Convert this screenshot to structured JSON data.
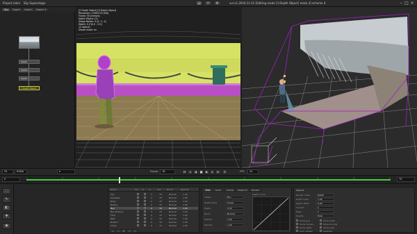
{
  "titlebar": {
    "project_label": "Project.mkm",
    "filename": "Sky Superstage",
    "title": "sur.v1.2019.11.01 [Editing mode [3 Depth Object] mask 4] scheme 4",
    "buttons": [
      "▤",
      "⟳",
      "⚙"
    ]
  },
  "tabs": [
    "Sky",
    "Depth 1",
    "Depth 2",
    "Depth 3"
  ],
  "nodes": {
    "items": [
      "Depth",
      "Depth 2",
      "Depth 3"
    ],
    "selected": "3 Depth Object"
  },
  "viewer": {
    "info": [
      "[3 Depth Object] [3 Depth Object]",
      "Resolution: 1280x720 [HD]",
      "Frame: 50 [frames]",
      "Depth Object: [3]",
      "Shape Nodes: 4 [4 / 1, 4]",
      "Depth: 0.0 [0.0 - 0.0]",
      "12 objects",
      "Shade mode: on"
    ]
  },
  "viewtool": {
    "zoom": "Fit",
    "channel": "RGBA",
    "frame_label": "Frame",
    "frame_value": "18",
    "fps_label": "FPS",
    "fps_value": "24"
  },
  "timeline": {
    "start": "0",
    "end": "70",
    "playhead": "18"
  },
  "layers": {
    "headers": [
      "Name",
      "Vis",
      "Lk",
      "In",
      "Out",
      "Blend",
      "Opacity"
    ],
    "rows": [
      {
        "name": "Sky",
        "in": "0",
        "out": "70",
        "blend": "Normal",
        "opacity": "1.00"
      },
      {
        "name": "Sea Base",
        "in": "0",
        "out": "70",
        "blend": "Normal",
        "opacity": "1.00"
      },
      {
        "name": "Rope",
        "in": "0",
        "out": "70",
        "blend": "Normal",
        "opacity": "1.00"
      },
      {
        "name": "Railing",
        "in": "0",
        "out": "70",
        "blend": "Normal",
        "opacity": "1.00"
      },
      {
        "name": "Boy",
        "in": "0",
        "out": "70",
        "blend": "Normal",
        "opacity": "1.00"
      },
      {
        "name": "Boy Shadow",
        "in": "0",
        "out": "70",
        "blend": "Normal",
        "opacity": "1.00"
      },
      {
        "name": "Floor",
        "in": "0",
        "out": "70",
        "blend": "Normal",
        "opacity": "1.00"
      },
      {
        "name": "Wall",
        "in": "0",
        "out": "70",
        "blend": "Normal",
        "opacity": "1.00"
      },
      {
        "name": "Bollard",
        "in": "0",
        "out": "70",
        "blend": "Normal",
        "opacity": "1.00"
      },
      {
        "name": "Chain",
        "in": "0",
        "out": "70",
        "blend": "Normal",
        "opacity": "1.00"
      }
    ],
    "selected_index": 4,
    "footer_buttons": [
      "+",
      "−",
      "⧉",
      "⇧",
      "⇩"
    ]
  },
  "properties": {
    "tabs": [
      "Edit",
      "Track",
      "Clamp",
      "Shape Fx",
      "Render"
    ],
    "fields": [
      {
        "label": "Shape",
        "value": "Boy"
      },
      {
        "label": "Depth Mode",
        "value": "Linear"
      },
      {
        "label": "Depth",
        "value": "0.50"
      },
      {
        "label": "Blend",
        "value": "Normal"
      },
      {
        "label": "Feather",
        "value": "2.00"
      },
      {
        "label": "Opacity",
        "value": "1.00"
      }
    ],
    "curve_title": "Depth Curve"
  },
  "settings": {
    "title": "Objects",
    "fields": [
      {
        "label": "Render mode",
        "value": "Depth"
      },
      {
        "label": "Depth scale",
        "value": "1.00"
      },
      {
        "label": "Depth offset",
        "value": "0.00"
      },
      {
        "label": "Smooth",
        "value": "2"
      },
      {
        "label": "Edge",
        "value": "1"
      },
      {
        "label": "Quality",
        "value": "High"
      }
    ],
    "checks": [
      "Show grid",
      "Show mesh",
      "Show camera",
      "Show bounds",
      "Show lights",
      "Show axes",
      "Auto update",
      "Realtime"
    ]
  },
  "colors": {
    "mask_magenta": "#b63fc9",
    "mask_yellow": "#d8e35a",
    "bbox_purple": "#a020c8",
    "timeline_green": "#3fcf3f",
    "selection_yellow": "#cfcf3a"
  }
}
